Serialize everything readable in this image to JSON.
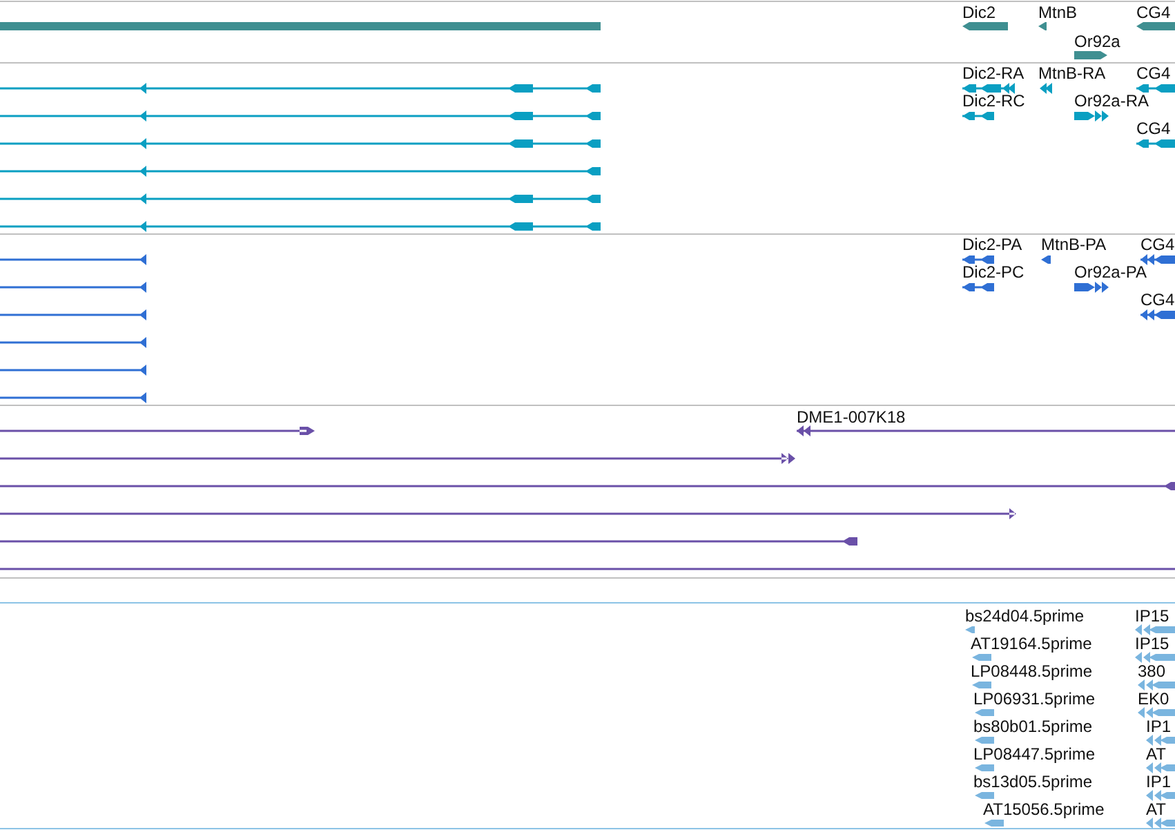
{
  "tracks": [
    {
      "kind": "gene",
      "color": "#3f8f91",
      "labels": [
        "Dic2",
        "MtnB",
        "CG4",
        "Or92a"
      ]
    },
    {
      "kind": "mrna",
      "color": "#0a9fc2",
      "labels": [
        "Dic2-RA",
        "MtnB-RA",
        "CG4",
        "Dic2-RC",
        "Or92a-RA",
        "CG4"
      ]
    },
    {
      "kind": "protein",
      "color": "#2f6fd4",
      "labels": [
        "Dic2-PA",
        "MtnB-PA",
        "CG4",
        "Dic2-PC",
        "Or92a-PA",
        "CG4"
      ]
    },
    {
      "kind": "clone",
      "color": "#6a50a8",
      "labels": [
        "DME1-007K18"
      ]
    },
    {
      "kind": "est",
      "color": "#7ab5df",
      "labels": [
        "bs24d04.5prime",
        "IP15",
        "AT19164.5prime",
        "IP15",
        "LP08448.5prime",
        "380",
        "LP06931.5prime",
        "EK0",
        "bs80b01.5prime",
        "IP1",
        "LP08447.5prime",
        "AT",
        "bs13d05.5prime",
        "IP1",
        "AT15056.5prime",
        "AT"
      ]
    }
  ]
}
